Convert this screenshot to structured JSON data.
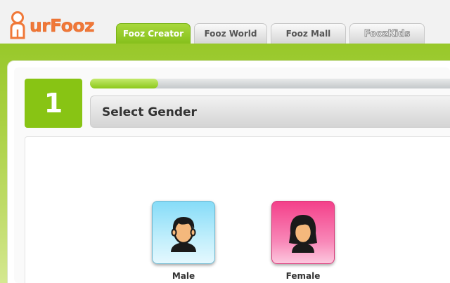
{
  "logo": {
    "text": "urFooz",
    "icon": "figure-icon"
  },
  "tabs": [
    {
      "label": "Fooz Creator",
      "active": true
    },
    {
      "label": "Fooz World",
      "active": false
    },
    {
      "label": "Fooz Mall",
      "active": false
    },
    {
      "label": "FoozKids",
      "label_parts": [
        "Fooz",
        "Kids"
      ],
      "active": false
    }
  ],
  "step": {
    "number": "1",
    "title": "Select Gender",
    "progress": 0.19
  },
  "genders": [
    {
      "label": "Male",
      "icon": "male-avatar-icon"
    },
    {
      "label": "Female",
      "icon": "female-avatar-icon"
    }
  ],
  "colors": {
    "accent_green": "#88c414",
    "logo_orange": "#f07838",
    "male_blue": "#86dcf8",
    "female_pink": "#f4408a"
  }
}
